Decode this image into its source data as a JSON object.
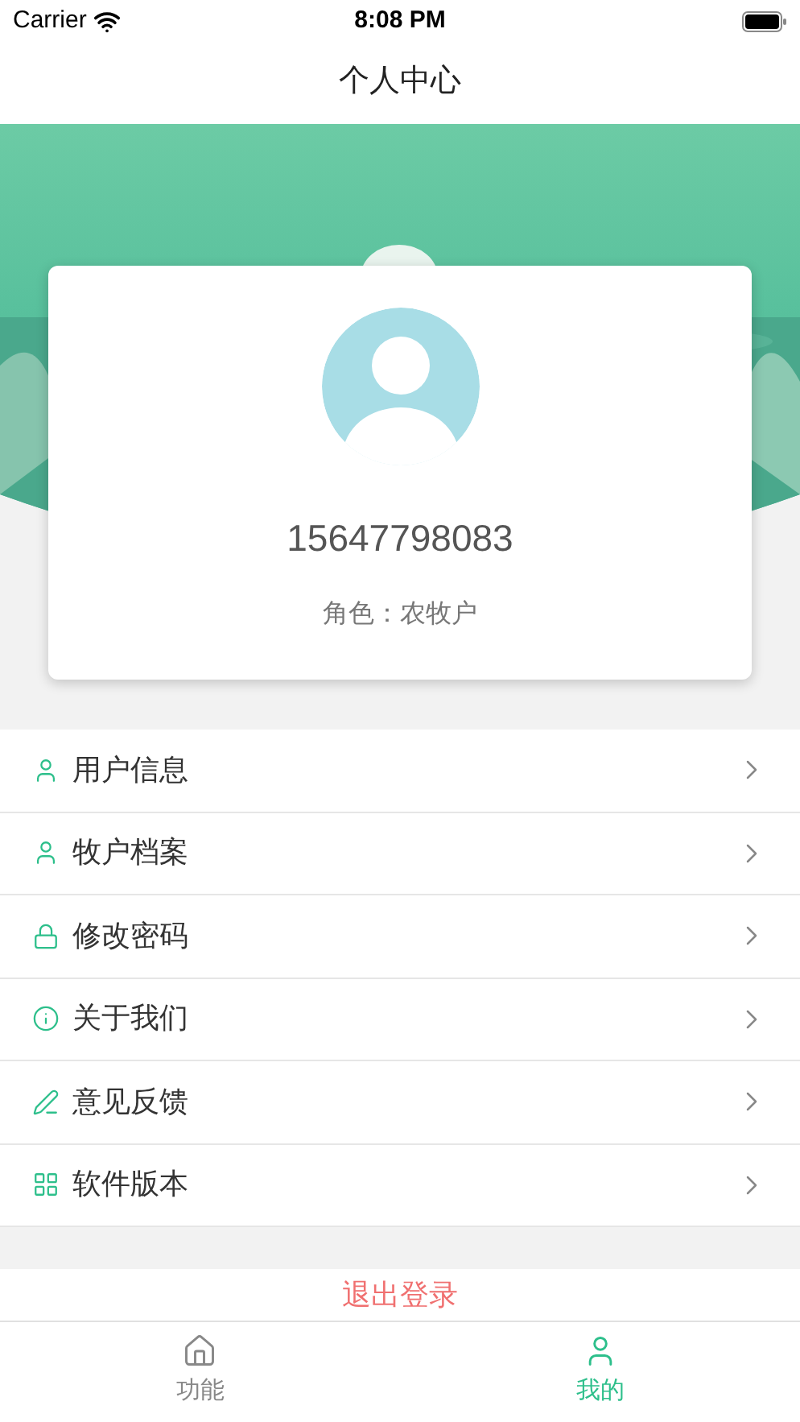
{
  "status_bar": {
    "carrier": "Carrier",
    "time": "8:08 PM"
  },
  "nav": {
    "title": "个人中心"
  },
  "profile": {
    "phone": "15647798083",
    "role": "角色：农牧户"
  },
  "menu": [
    {
      "label": "用户信息",
      "kind": "user"
    },
    {
      "label": "牧户档案",
      "kind": "user"
    },
    {
      "label": "修改密码",
      "kind": "lock"
    },
    {
      "label": "关于我们",
      "kind": "info"
    },
    {
      "label": "意见反馈",
      "kind": "pen"
    },
    {
      "label": "软件版本",
      "kind": "grid"
    }
  ],
  "logout": "退出登录",
  "tabs": [
    {
      "label": "功能",
      "kind": "home",
      "selected": false
    },
    {
      "label": "我的",
      "kind": "user",
      "selected": true
    }
  ]
}
